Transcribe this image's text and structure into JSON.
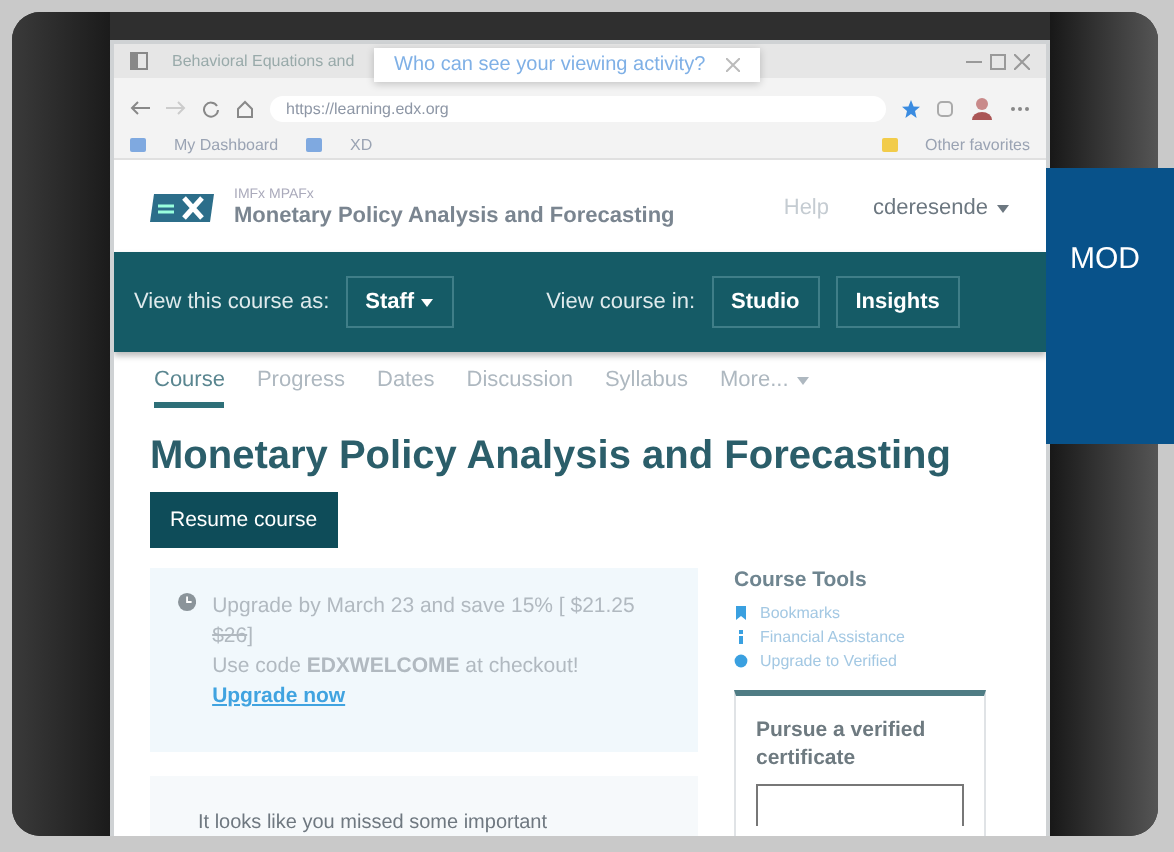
{
  "browser": {
    "tabs": [
      {
        "label": "Behavioral Equations and",
        "selected": false
      }
    ],
    "popup": "Who can see your viewing activity?",
    "address": "https://learning.edx.org",
    "bookmarks": [
      {
        "label": "My Dashboard"
      },
      {
        "label": "XD"
      },
      {
        "label": "Other favorites"
      }
    ]
  },
  "header": {
    "org": "IMFx MPAFx",
    "course_title": "Monetary Policy Analysis and Forecasting",
    "help": "Help",
    "user": "cderesende"
  },
  "staff_bar": {
    "view_as_label": "View this course as:",
    "view_as": "Staff",
    "view_in_label": "View course in:",
    "buttons": [
      "Studio",
      "Insights"
    ]
  },
  "nav": [
    {
      "label": "Course",
      "selected": true
    },
    {
      "label": "Progress",
      "selected": false
    },
    {
      "label": "Dates",
      "selected": false
    },
    {
      "label": "Discussion",
      "selected": false
    },
    {
      "label": "Syllabus",
      "selected": false
    },
    {
      "label": "More...",
      "selected": false
    }
  ],
  "title": "Monetary Policy Analysis and Forecasting",
  "resume": "Resume course",
  "upgrade": {
    "offer": "Upgrade by March 23 and save 15% [",
    "price": "$21.25",
    "old_price": "$26",
    "close": "]",
    "code": "Use code **EDXWELCOME** at checkout!",
    "link": "Upgrade now"
  },
  "tools": {
    "title": "Course Tools",
    "items": [
      {
        "kind": "bookmark",
        "label": "Bookmarks"
      },
      {
        "kind": "info",
        "label": "Financial Assistance"
      },
      {
        "kind": "dot",
        "label": "Upgrade to Verified"
      }
    ]
  },
  "verified": "Pursue a verified certificate",
  "alert": "It looks like you missed some important",
  "overlay": "MOD"
}
